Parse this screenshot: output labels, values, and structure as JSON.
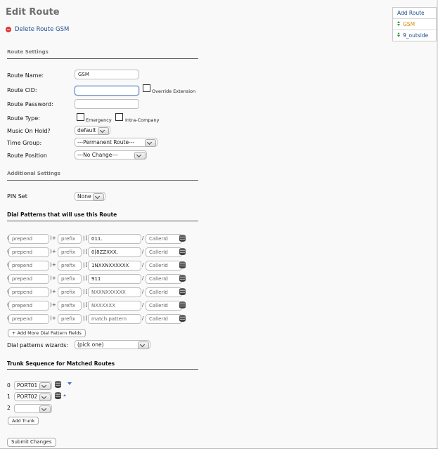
{
  "page": {
    "title": "Edit Route",
    "delete_label": "Delete Route GSM"
  },
  "sidebar": {
    "add_label": "Add Route",
    "routes": [
      {
        "label": "GSM",
        "current": true
      },
      {
        "label": "9_outside",
        "current": false
      }
    ]
  },
  "route_settings": {
    "heading": "Route Settings",
    "name_label": "Route Name:",
    "name_value": "GSM",
    "cid_label": "Route CID:",
    "cid_value": "",
    "override_label": "Override Extension",
    "password_label": "Route Password:",
    "password_value": "",
    "type_label": "Route Type:",
    "emergency_label": "Emergency",
    "intracompany_label": "Intra-Company",
    "moh_label": "Music On Hold?",
    "moh_value": "default",
    "timegroup_label": "Time Group:",
    "timegroup_value": "---Permanent Route---",
    "position_label": "Route Position",
    "position_value": "---No Change---"
  },
  "additional_settings": {
    "heading": "Additional Settings",
    "pinset_label": "PIN Set",
    "pinset_value": "None"
  },
  "dial_patterns": {
    "heading": "Dial Patterns that will use this Route",
    "rows": [
      {
        "prepend": "prepend",
        "prefix": "prefix",
        "pattern": "011.",
        "callerid": "CallerId",
        "pattern_placeholder": false
      },
      {
        "prepend": "prepend",
        "prefix": "prefix",
        "pattern": "0[8ZZXXX.",
        "callerid": "CallerId",
        "pattern_placeholder": false
      },
      {
        "prepend": "prepend",
        "prefix": "prefix",
        "pattern": "1NXXNXXXXXX",
        "callerid": "CallerId",
        "pattern_placeholder": false
      },
      {
        "prepend": "prepend",
        "prefix": "prefix",
        "pattern": "911",
        "callerid": "CallerId",
        "pattern_placeholder": false
      },
      {
        "prepend": "prepend",
        "prefix": "prefix",
        "pattern": "NXXNXXXXXX",
        "callerid": "CallerId",
        "pattern_placeholder": true
      },
      {
        "prepend": "prepend",
        "prefix": "prefix",
        "pattern": "NXXXXXX",
        "callerid": "CallerId",
        "pattern_placeholder": true
      },
      {
        "prepend": "prepend",
        "prefix": "prefix",
        "pattern": "match pattern",
        "callerid": "CallerId",
        "pattern_placeholder": true
      }
    ],
    "add_more_label": "+ Add More Dial Pattern Fields",
    "wizard_label": "Dial patterns wizards:",
    "wizard_value": "(pick one)"
  },
  "trunks": {
    "heading": "Trunk Sequence for Matched Routes",
    "rows": [
      {
        "index": "0",
        "value": "PORT01"
      },
      {
        "index": "1",
        "value": "PORT02"
      },
      {
        "index": "2",
        "value": ""
      }
    ],
    "add_label": "Add Trunk"
  },
  "submit_label": "Submit Changes"
}
